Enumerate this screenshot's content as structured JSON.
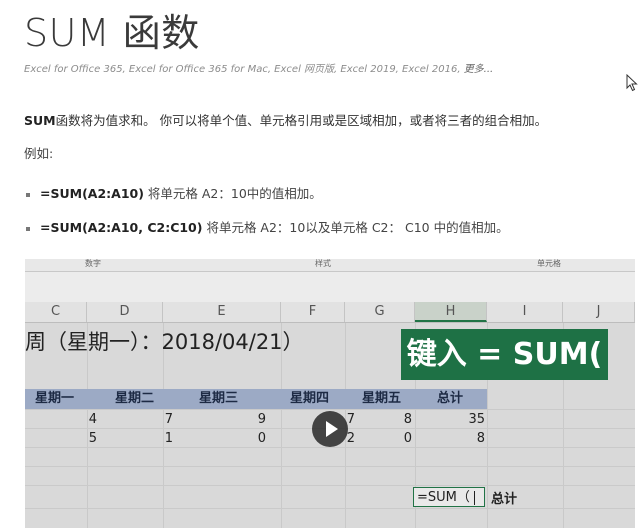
{
  "page": {
    "title": "SUM 函数",
    "applies_to": "Excel for Office 365, Excel for Office 365 for Mac, Excel 网页版, Excel 2019, Excel 2016, ",
    "applies_more": "更多...",
    "description_bold": "SUM",
    "description_rest": "函数将为值求和。 你可以将单个值、单元格引用或是区域相加，或者将三者的组合相加。",
    "example_label": "例如:",
    "bullets": [
      {
        "formula": "=SUM(A2:A10)",
        "text": " 将单元格 A2：10中的值相加。"
      },
      {
        "formula": "=SUM(A2:A10, C2:C10)",
        "text": " 将单元格 A2：10以及单元格 C2： C10 中的值相加。"
      }
    ]
  },
  "video": {
    "ribbon_groups": [
      "数字",
      "样式",
      "单元格"
    ],
    "columns": [
      "C",
      "D",
      "E",
      "F",
      "G",
      "H",
      "I",
      "J"
    ],
    "active_column": "H",
    "sheet_title": "周（星期一）：2018/04/21）",
    "overlay_text": "键入 = SUM(",
    "headers": [
      "星期一",
      "星期二",
      "星期三",
      "星期四",
      "星期五",
      "总计"
    ],
    "rows": [
      [
        "4",
        "7",
        "9",
        "7",
        "8",
        "35"
      ],
      [
        "5",
        "1",
        "0",
        "2",
        "0",
        "8"
      ]
    ],
    "formula_cell": "=SUM（",
    "total_label": "总计",
    "play_icon": "play-icon"
  }
}
